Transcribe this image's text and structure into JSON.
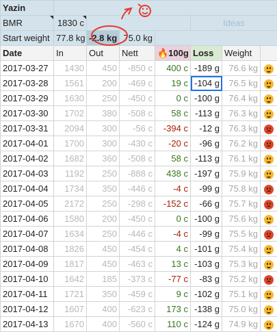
{
  "header": {
    "name": "Yazin",
    "bmr_label": "BMR",
    "bmr_value": "1830 c",
    "start_label": "Start weight",
    "start_value": "77.8 kg",
    "delta_value": "-2.8 kg",
    "current_value": "75.0 kg",
    "ideas_label": "Ideas"
  },
  "columns": {
    "date": "Date",
    "in": "In",
    "out": "Out",
    "nett": "Nett",
    "gain": "🔥100g",
    "loss": "Loss",
    "weight": "Weight"
  },
  "rows": [
    {
      "date": "2017-03-27",
      "in": "1430",
      "out": "450",
      "nett": "-850 c",
      "gain": "400 c",
      "loss": "-189 g",
      "weight": "76.6 kg",
      "mood": "happy",
      "gain_sign": "pos"
    },
    {
      "date": "2017-03-28",
      "in": "1561",
      "out": "200",
      "nett": "-469 c",
      "gain": "19 c",
      "loss": "-104 g",
      "weight": "76.5 kg",
      "mood": "happy",
      "gain_sign": "pos"
    },
    {
      "date": "2017-03-29",
      "in": "1630",
      "out": "250",
      "nett": "-450 c",
      "gain": "0 c",
      "loss": "-100 g",
      "weight": "76.4 kg",
      "mood": "happy",
      "gain_sign": "pos"
    },
    {
      "date": "2017-03-30",
      "in": "1702",
      "out": "380",
      "nett": "-508 c",
      "gain": "58 c",
      "loss": "-113 g",
      "weight": "76.3 kg",
      "mood": "happy",
      "gain_sign": "pos"
    },
    {
      "date": "2017-03-31",
      "in": "2094",
      "out": "300",
      "nett": "-56 c",
      "gain": "-394 c",
      "loss": "-12 g",
      "weight": "76.3 kg",
      "mood": "angry",
      "gain_sign": "neg"
    },
    {
      "date": "2017-04-01",
      "in": "1700",
      "out": "300",
      "nett": "-430 c",
      "gain": "-20 c",
      "loss": "-96 g",
      "weight": "76.2 kg",
      "mood": "angry",
      "gain_sign": "neg"
    },
    {
      "date": "2017-04-02",
      "in": "1682",
      "out": "360",
      "nett": "-508 c",
      "gain": "58 c",
      "loss": "-113 g",
      "weight": "76.1 kg",
      "mood": "happy",
      "gain_sign": "pos"
    },
    {
      "date": "2017-04-03",
      "in": "1192",
      "out": "250",
      "nett": "-888 c",
      "gain": "438 c",
      "loss": "-197 g",
      "weight": "75.9 kg",
      "mood": "happy",
      "gain_sign": "pos"
    },
    {
      "date": "2017-04-04",
      "in": "1734",
      "out": "350",
      "nett": "-446 c",
      "gain": "-4 c",
      "loss": "-99 g",
      "weight": "75.8 kg",
      "mood": "angry",
      "gain_sign": "neg"
    },
    {
      "date": "2017-04-05",
      "in": "2172",
      "out": "250",
      "nett": "-298 c",
      "gain": "-152 c",
      "loss": "-66 g",
      "weight": "75.7 kg",
      "mood": "angry",
      "gain_sign": "neg"
    },
    {
      "date": "2017-04-06",
      "in": "1580",
      "out": "200",
      "nett": "-450 c",
      "gain": "0 c",
      "loss": "-100 g",
      "weight": "75.6 kg",
      "mood": "happy",
      "gain_sign": "pos"
    },
    {
      "date": "2017-04-07",
      "in": "1634",
      "out": "250",
      "nett": "-446 c",
      "gain": "-4 c",
      "loss": "-99 g",
      "weight": "75.5 kg",
      "mood": "angry",
      "gain_sign": "neg"
    },
    {
      "date": "2017-04-08",
      "in": "1826",
      "out": "450",
      "nett": "-454 c",
      "gain": "4 c",
      "loss": "-101 g",
      "weight": "75.4 kg",
      "mood": "happy",
      "gain_sign": "pos"
    },
    {
      "date": "2017-04-09",
      "in": "1817",
      "out": "450",
      "nett": "-463 c",
      "gain": "13 c",
      "loss": "-103 g",
      "weight": "75.3 kg",
      "mood": "happy",
      "gain_sign": "pos"
    },
    {
      "date": "2017-04-10",
      "in": "1642",
      "out": "185",
      "nett": "-373 c",
      "gain": "-77 c",
      "loss": "-83 g",
      "weight": "75.2 kg",
      "mood": "angry",
      "gain_sign": "neg"
    },
    {
      "date": "2017-04-11",
      "in": "1721",
      "out": "350",
      "nett": "-459 c",
      "gain": "9 c",
      "loss": "-102 g",
      "weight": "75.1 kg",
      "mood": "happy",
      "gain_sign": "pos"
    },
    {
      "date": "2017-04-12",
      "in": "1607",
      "out": "400",
      "nett": "-623 c",
      "gain": "173 c",
      "loss": "-138 g",
      "weight": "75.0 kg",
      "mood": "happy",
      "gain_sign": "pos"
    },
    {
      "date": "2017-04-13",
      "in": "1670",
      "out": "400",
      "nett": "-560 c",
      "gain": "110 c",
      "loss": "-124 g",
      "weight": "74.9 kg",
      "mood": "happy",
      "gain_sign": "pos"
    }
  ],
  "colors": {
    "header_bg": "#d4e3eb",
    "positive": "#38761d",
    "negative": "#a61c00",
    "annotation": "#e53935",
    "selection": "#1a73e8"
  }
}
